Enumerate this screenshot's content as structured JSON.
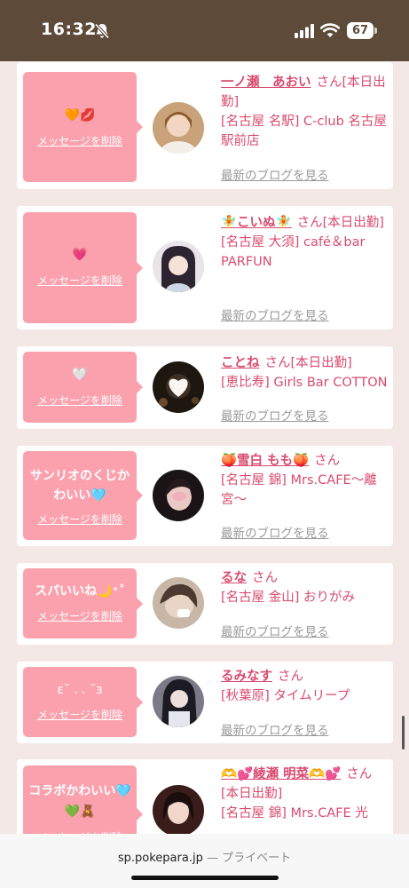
{
  "status": {
    "time": "16:32",
    "battery": "67"
  },
  "delete_label": "メッセージを削除",
  "blog_label": "最新のブログを見る",
  "san": "さん",
  "entries": [
    {
      "message": "🧡💋",
      "name": "一ノ瀬　あおい",
      "status": "[本日出勤]",
      "shop": "[名古屋 名駅] C-club 名古屋駅前店"
    },
    {
      "message": "💗",
      "name": "🧚こいぬ🧚",
      "status": "[本日出勤]",
      "shop": "[名古屋 大須] café＆bar PARFUN"
    },
    {
      "message": "🤍",
      "name": "ことね",
      "status": "[本日出勤]",
      "shop": "[恵比寿] Girls Bar COTTON"
    },
    {
      "message_lines": [
        "サンリオのくじか",
        "わいい🩵"
      ],
      "name": "🍑雪白 もも🍑",
      "status": "",
      "shop": "[名古屋 錦] Mrs.CAFE〜離宮〜"
    },
    {
      "message": "スパいいね🌙⁺˚",
      "name": "るな",
      "status": "",
      "shop": "[名古屋 金山] おりがみ"
    },
    {
      "message": "ε˘ . . ˘з",
      "name": "るみなす",
      "status": "",
      "shop": "[秋葉原] タイムリープ"
    },
    {
      "message_lines": [
        "コラボかわいい🩵",
        "💚🧸"
      ],
      "name": "🫶💕綾瀬 明菜🫶💕",
      "status": "[本日出勤]",
      "shop": "[名古屋 錦] Mrs.CAFE 光"
    }
  ],
  "browser": {
    "url": "sp.pokepara.jp",
    "separator": "—",
    "mode": "プライベート"
  }
}
